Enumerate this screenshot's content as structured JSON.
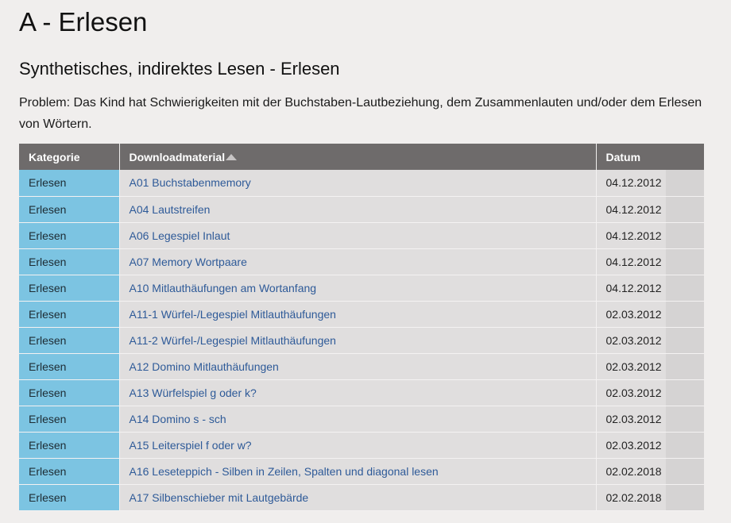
{
  "page": {
    "title": "A - Erlesen",
    "subtitle": "Synthetisches, indirektes Lesen - Erlesen",
    "problem": "Problem: Das Kind hat Schwierigkeiten mit der Buchstaben-Lautbeziehung, dem Zusammenlauten und/oder dem Erlesen von Wörtern."
  },
  "table": {
    "headers": {
      "kategorie": "Kategorie",
      "downloadmaterial": "Downloadmaterial",
      "datum": "Datum"
    },
    "sort": {
      "column": "downloadmaterial",
      "direction": "ascending"
    },
    "colors": {
      "header_bg": "#6e6b6b",
      "category_bg": "#7cc4e2",
      "row_bg": "#e0dede",
      "link": "#2e5a98"
    },
    "rows": [
      {
        "kategorie": "Erlesen",
        "material": "A01 Buchstabenmemory",
        "datum": "04.12.2012"
      },
      {
        "kategorie": "Erlesen",
        "material": "A04 Lautstreifen",
        "datum": "04.12.2012"
      },
      {
        "kategorie": "Erlesen",
        "material": "A06 Legespiel Inlaut",
        "datum": "04.12.2012"
      },
      {
        "kategorie": "Erlesen",
        "material": "A07 Memory Wortpaare",
        "datum": "04.12.2012"
      },
      {
        "kategorie": "Erlesen",
        "material": "A10 Mitlauthäufungen am Wortanfang",
        "datum": "04.12.2012"
      },
      {
        "kategorie": "Erlesen",
        "material": "A11-1 Würfel-/Legespiel Mitlauthäufungen",
        "datum": "02.03.2012"
      },
      {
        "kategorie": "Erlesen",
        "material": "A11-2 Würfel-/Legespiel Mitlauthäufungen",
        "datum": "02.03.2012"
      },
      {
        "kategorie": "Erlesen",
        "material": "A12 Domino Mitlauthäufungen",
        "datum": "02.03.2012"
      },
      {
        "kategorie": "Erlesen",
        "material": "A13 Würfelspiel g oder k?",
        "datum": "02.03.2012"
      },
      {
        "kategorie": "Erlesen",
        "material": "A14 Domino s - sch",
        "datum": "02.03.2012"
      },
      {
        "kategorie": "Erlesen",
        "material": "A15 Leiterspiel f oder w?",
        "datum": "02.03.2012"
      },
      {
        "kategorie": "Erlesen",
        "material": "A16 Leseteppich - Silben in Zeilen, Spalten und diagonal lesen",
        "datum": "02.02.2018"
      },
      {
        "kategorie": "Erlesen",
        "material": "A17 Silbenschieber mit Lautgebärde",
        "datum": "02.02.2018"
      }
    ]
  }
}
